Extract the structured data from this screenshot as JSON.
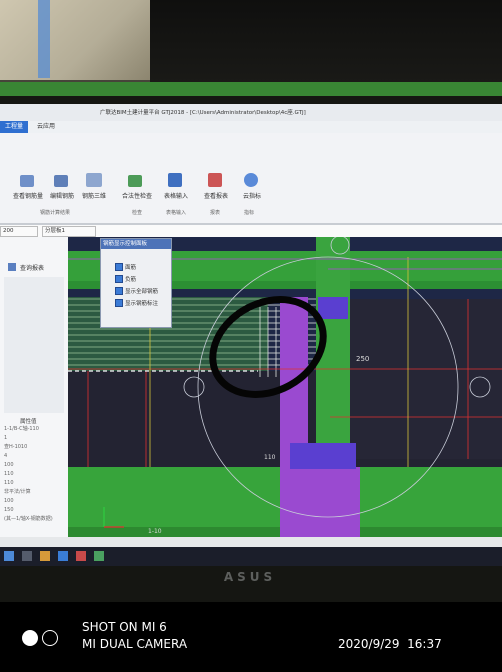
{
  "app": {
    "window_title": "广联达BIM土建计量平台 GTJ2018 - [C:\\Users\\Administrator\\Desktop\\4c座.GTJ]",
    "tabs": [
      "工程量",
      "云应用"
    ],
    "ribbon_buttons": [
      "查看钢筋量",
      "编辑钢筋",
      "钢筋三维",
      "合法性检查",
      "表格输入",
      "查看报表",
      "云指标"
    ],
    "ribbon_groups": [
      "钢筋计算结果",
      "检查",
      "表格输入",
      "报表",
      "指标"
    ],
    "floor_dropdown": "200",
    "layer_dropdown": "分层板1"
  },
  "side_panel": {
    "label": "查询报表",
    "params_title": "属性值",
    "param_lines": [
      "1-1/B-C轴-110",
      "1",
      "查H-1010",
      "4",
      "100",
      "110",
      "110",
      "非平法/计算",
      "100",
      "150",
      "(其—1/轴X-钢筋数据)"
    ]
  },
  "dialog": {
    "title": "钢筋显示控制面板",
    "options": [
      "面筋",
      "负筋",
      "显示全部钢筋",
      "显示钢筋标注"
    ]
  },
  "canvas_labels": [
    "250",
    "110",
    "1-10"
  ],
  "photo_caption": {
    "line1": "SHOT ON MI 6",
    "line2": "MI DUAL CAMERA",
    "timestamp": "2020/9/29  16:37"
  },
  "laptop_brand": "ASUS"
}
